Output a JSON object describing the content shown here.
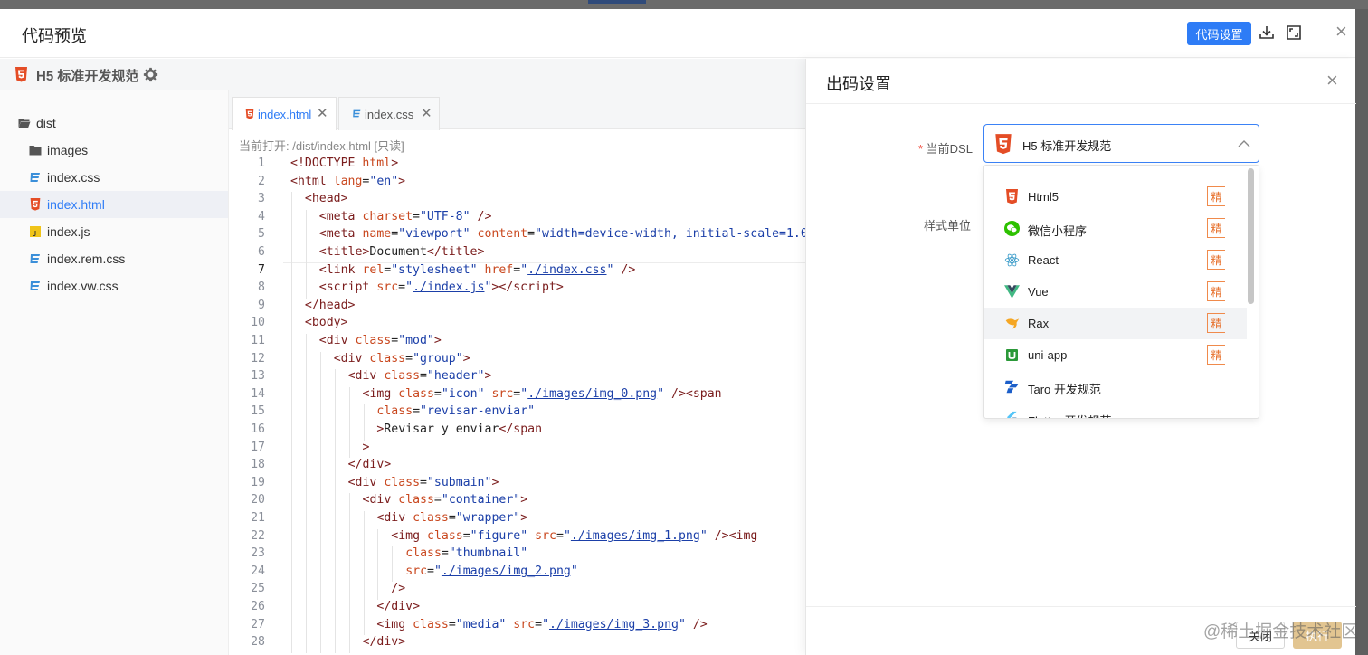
{
  "modal": {
    "title": "代码预览",
    "settings_button": "代码设置"
  },
  "spec": {
    "label": "H5 标准开发规范"
  },
  "file_tree": [
    {
      "name": "dist",
      "type": "folder-open",
      "active": false
    },
    {
      "name": "images",
      "type": "folder",
      "active": false
    },
    {
      "name": "index.css",
      "type": "css",
      "active": false
    },
    {
      "name": "index.html",
      "type": "html",
      "active": true
    },
    {
      "name": "index.js",
      "type": "js",
      "active": false
    },
    {
      "name": "index.rem.css",
      "type": "css",
      "active": false
    },
    {
      "name": "index.vw.css",
      "type": "css",
      "active": false
    }
  ],
  "tabs": [
    {
      "label": "index.html",
      "active": true
    },
    {
      "label": "index.css",
      "active": false
    }
  ],
  "opened_file": "当前打开: /dist/index.html [只读]",
  "code": {
    "current_line": 7,
    "lines": [
      {
        "n": "1",
        "indent": 0,
        "html": "<span class=\"tg\">&lt;!DOCTYPE</span> <span class=\"at\">html</span><span class=\"tg\">&gt;</span>"
      },
      {
        "n": "2",
        "indent": 0,
        "html": "<span class=\"tg\">&lt;html</span> <span class=\"at\">lang</span>=<span class=\"st\">\"en\"</span><span class=\"tg\">&gt;</span>"
      },
      {
        "n": "3",
        "indent": 1,
        "html": "<span class=\"tg\">&lt;head&gt;</span>"
      },
      {
        "n": "4",
        "indent": 2,
        "html": "<span class=\"tg\">&lt;meta</span> <span class=\"at\">charset</span>=<span class=\"st\">\"UTF-8\"</span> <span class=\"tg\">/&gt;</span>"
      },
      {
        "n": "5",
        "indent": 2,
        "html": "<span class=\"tg\">&lt;meta</span> <span class=\"at\">name</span>=<span class=\"st\">\"viewport\"</span> <span class=\"at\">content</span>=<span class=\"st\">\"width=device-width, initial-scale=1.0\"</span>"
      },
      {
        "n": "6",
        "indent": 2,
        "html": "<span class=\"tg\">&lt;title&gt;</span>Document<span class=\"tg\">&lt;/title&gt;</span>"
      },
      {
        "n": "7",
        "indent": 2,
        "html": "<span class=\"tg\">&lt;link</span> <span class=\"at\">rel</span>=<span class=\"st\">\"stylesheet\"</span> <span class=\"at\">href</span>=<span class=\"st\">\"<span class=\"lk\">./index.css</span>\"</span> <span class=\"tg\">/&gt;</span>"
      },
      {
        "n": "8",
        "indent": 2,
        "html": "<span class=\"tg\">&lt;script</span> <span class=\"at\">src</span>=<span class=\"st\">\"<span class=\"lk\">./index.js</span>\"</span><span class=\"tg\">&gt;&lt;/script&gt;</span>"
      },
      {
        "n": "9",
        "indent": 1,
        "html": "<span class=\"tg\">&lt;/head&gt;</span>"
      },
      {
        "n": "10",
        "indent": 1,
        "html": "<span class=\"tg\">&lt;body&gt;</span>"
      },
      {
        "n": "11",
        "indent": 2,
        "html": "<span class=\"tg\">&lt;div</span> <span class=\"at\">class</span>=<span class=\"st\">\"mod\"</span><span class=\"tg\">&gt;</span>"
      },
      {
        "n": "12",
        "indent": 3,
        "html": "<span class=\"tg\">&lt;div</span> <span class=\"at\">class</span>=<span class=\"st\">\"group\"</span><span class=\"tg\">&gt;</span>"
      },
      {
        "n": "13",
        "indent": 4,
        "html": "<span class=\"tg\">&lt;div</span> <span class=\"at\">class</span>=<span class=\"st\">\"header\"</span><span class=\"tg\">&gt;</span>"
      },
      {
        "n": "14",
        "indent": 5,
        "html": "<span class=\"tg\">&lt;img</span> <span class=\"at\">class</span>=<span class=\"st\">\"icon\"</span> <span class=\"at\">src</span>=<span class=\"st\">\"<span class=\"lk\">./images/img_0.png</span>\"</span> <span class=\"tg\">/&gt;&lt;span</span>"
      },
      {
        "n": "15",
        "indent": 6,
        "html": "<span class=\"at\">class</span>=<span class=\"st\">\"revisar-enviar\"</span>"
      },
      {
        "n": "16",
        "indent": 6,
        "html": "<span class=\"tg\">&gt;</span>Revisar y enviar<span class=\"tg\">&lt;/span</span>"
      },
      {
        "n": "17",
        "indent": 5,
        "html": "<span class=\"tg\">&gt;</span>"
      },
      {
        "n": "18",
        "indent": 4,
        "html": "<span class=\"tg\">&lt;/div&gt;</span>"
      },
      {
        "n": "19",
        "indent": 4,
        "html": "<span class=\"tg\">&lt;div</span> <span class=\"at\">class</span>=<span class=\"st\">\"submain\"</span><span class=\"tg\">&gt;</span>"
      },
      {
        "n": "20",
        "indent": 5,
        "html": "<span class=\"tg\">&lt;div</span> <span class=\"at\">class</span>=<span class=\"st\">\"container\"</span><span class=\"tg\">&gt;</span>"
      },
      {
        "n": "21",
        "indent": 6,
        "html": "<span class=\"tg\">&lt;div</span> <span class=\"at\">class</span>=<span class=\"st\">\"wrapper\"</span><span class=\"tg\">&gt;</span>"
      },
      {
        "n": "22",
        "indent": 7,
        "html": "<span class=\"tg\">&lt;img</span> <span class=\"at\">class</span>=<span class=\"st\">\"figure\"</span> <span class=\"at\">src</span>=<span class=\"st\">\"<span class=\"lk\">./images/img_1.png</span>\"</span> <span class=\"tg\">/&gt;&lt;img</span>"
      },
      {
        "n": "23",
        "indent": 8,
        "html": "<span class=\"at\">class</span>=<span class=\"st\">\"thumbnail\"</span>"
      },
      {
        "n": "24",
        "indent": 8,
        "html": "<span class=\"at\">src</span>=<span class=\"st\">\"<span class=\"lk\">./images/img_2.png</span>\"</span>"
      },
      {
        "n": "25",
        "indent": 7,
        "html": "<span class=\"tg\">/&gt;</span>"
      },
      {
        "n": "26",
        "indent": 6,
        "html": "<span class=\"tg\">&lt;/div&gt;</span>"
      },
      {
        "n": "27",
        "indent": 6,
        "html": "<span class=\"tg\">&lt;img</span> <span class=\"at\">class</span>=<span class=\"st\">\"media\"</span> <span class=\"at\">src</span>=<span class=\"st\">\"<span class=\"lk\">./images/img_3.png</span>\"</span> <span class=\"tg\">/&gt;</span>"
      },
      {
        "n": "28",
        "indent": 5,
        "html": "<span class=\"tg\">&lt;/div&gt;</span>"
      }
    ]
  },
  "drawer": {
    "title": "出码设置",
    "dsl_label": "当前DSL",
    "dsl_value": "H5 标准开发规范",
    "style_unit_label": "样式单位",
    "options": [
      {
        "label": "Html5",
        "icon": "html5-icon",
        "tag": "精"
      },
      {
        "label": "微信小程序",
        "icon": "wechat-icon",
        "tag": "精"
      },
      {
        "label": "React",
        "icon": "react-icon",
        "tag": "精"
      },
      {
        "label": "Vue",
        "icon": "vue-icon",
        "tag": "精"
      },
      {
        "label": "Rax",
        "icon": "rax-icon",
        "tag": "精",
        "hover": true
      },
      {
        "label": "uni-app",
        "icon": "uniapp-icon",
        "tag": "精"
      },
      {
        "label": "Taro 开发规范",
        "icon": "taro-icon",
        "tag": ""
      },
      {
        "label": "Flutter 开发规范",
        "icon": "flutter-icon",
        "tag": ""
      }
    ],
    "cancel_label": "关闭",
    "ok_label": "执行"
  },
  "watermark": "@稀土掘金技术社区",
  "colors": {
    "primary": "#2e7cf6",
    "html_orange": "#e44d26",
    "css_blue": "#3b8fd9",
    "js_yellow": "#f0c419",
    "tag_orange": "#e76f2a"
  }
}
